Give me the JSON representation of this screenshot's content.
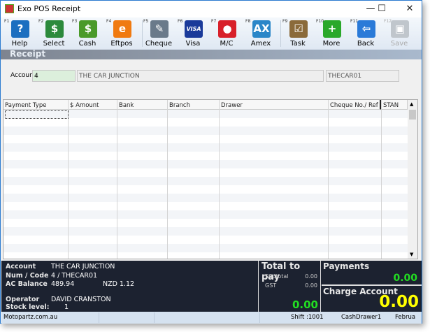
{
  "window": {
    "title": "Exo POS  Receipt",
    "controls": [
      "minimize",
      "maximize",
      "close"
    ]
  },
  "toolbar": [
    {
      "key": "F1",
      "label": "Help",
      "icon": "help-icon",
      "color": "#1c6fc0",
      "glyph": "?"
    },
    {
      "key": "F2",
      "label": "Select",
      "icon": "select-icon",
      "color": "#2c8a3c",
      "glyph": "$"
    },
    {
      "key": "F3",
      "label": "Cash",
      "icon": "cash-icon",
      "color": "#4a9a2a",
      "glyph": "$"
    },
    {
      "key": "F4",
      "label": "Eftpos",
      "icon": "eftpos-icon",
      "color": "#f07a10",
      "glyph": "e"
    },
    {
      "key": "F5",
      "label": "Cheque",
      "icon": "cheque-icon",
      "color": "#6a7a8a",
      "glyph": "✎"
    },
    {
      "key": "F6",
      "label": "Visa",
      "icon": "visa-icon",
      "color": "#1a3a9a",
      "glyph": "VISA"
    },
    {
      "key": "F7",
      "label": "M/C",
      "icon": "mastercard-icon",
      "color": "#d8202a",
      "glyph": "●"
    },
    {
      "key": "F8",
      "label": "Amex",
      "icon": "amex-icon",
      "color": "#2a86c8",
      "glyph": "AX"
    },
    {
      "key": "F9",
      "label": "Task",
      "icon": "task-icon",
      "color": "#8a6a3a",
      "glyph": "☑"
    },
    {
      "key": "F10",
      "label": "More",
      "icon": "more-icon",
      "color": "#2aa82a",
      "glyph": "+"
    },
    {
      "key": "F11",
      "label": "Back",
      "icon": "back-icon",
      "color": "#2a7ad8",
      "glyph": "⇦"
    },
    {
      "key": "F12",
      "label": "Save",
      "icon": "save-icon",
      "color": "#c0c6cc",
      "glyph": "▣",
      "disabled": true
    }
  ],
  "section_title": "Receipt",
  "account": {
    "label": "Account",
    "number": "4",
    "name": "THE CAR JUNCTION",
    "code": "THECAR01"
  },
  "grid": {
    "columns": [
      "Payment Type",
      "$ Amount",
      "Bank",
      "Branch",
      "Drawer",
      "Cheque No./ Ref",
      "STAN"
    ]
  },
  "summary": {
    "account_label": "Account",
    "account_value": "THE CAR JUNCTION",
    "numcode_label": "Num / Code",
    "numcode_value": "4 / THECAR01",
    "balance_label": "AC Balance",
    "balance_value": "489.94",
    "currency": "NZD 1.12",
    "operator_label": "Operator",
    "operator_value": "DAVID CRANSTON",
    "stock_label": "Stock level:",
    "stock_value": "1"
  },
  "totals": {
    "title": "Total to pay",
    "subtotal_label": "Subtotal",
    "subtotal": "0.00",
    "gst_label": "GST",
    "gst": "0.00",
    "total": "0.00"
  },
  "payments": {
    "title": "Payments",
    "value": "0.00"
  },
  "charge": {
    "title": "Charge Account",
    "value": "0.00"
  },
  "status": {
    "site": "Motopartz.com.au",
    "shift": "Shift :1001",
    "drawer": "CashDrawer1",
    "date": "Februa"
  },
  "colors": {
    "green": "#22dd22",
    "yellow": "#ffff00",
    "panel": "#1c2230"
  }
}
